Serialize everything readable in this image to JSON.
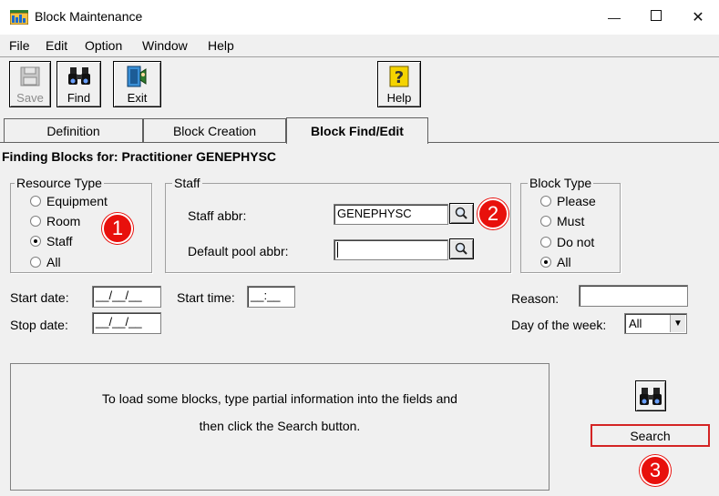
{
  "window": {
    "title": "Block Maintenance",
    "minimize_glyph": "—",
    "maximize_glyph": "☐",
    "close_glyph": "✕"
  },
  "menu": [
    "File",
    "Edit",
    "Option",
    "Window",
    "Help"
  ],
  "toolbar": {
    "save": "Save",
    "find": "Find",
    "exit": "Exit",
    "help": "Help"
  },
  "tabs": [
    {
      "label": "Definition",
      "active": false
    },
    {
      "label": "Block Creation",
      "active": false
    },
    {
      "label": "Block Find/Edit",
      "active": true
    }
  ],
  "finding_label": "Finding Blocks for: Practitioner GENEPHYSC",
  "resource_type": {
    "legend": "Resource Type",
    "options": [
      "Equipment",
      "Room",
      "Staff",
      "All"
    ],
    "selected": "Staff"
  },
  "staff": {
    "legend": "Staff",
    "staff_abbr_label": "Staff abbr:",
    "staff_abbr_value": "GENEPHYSC",
    "default_pool_label": "Default pool abbr:",
    "default_pool_value": ""
  },
  "block_type": {
    "legend": "Block Type",
    "options": [
      "Please",
      "Must",
      "Do not",
      "All"
    ],
    "selected": "All"
  },
  "dates": {
    "start_date_label": "Start date:",
    "start_date_value": "__/__/__",
    "stop_date_label": "Stop date:",
    "stop_date_value": "__/__/__",
    "start_time_label": "Start time:",
    "start_time_value": "__:__"
  },
  "reason": {
    "label": "Reason:",
    "value": ""
  },
  "day_of_week": {
    "label": "Day of the week:",
    "value": "All"
  },
  "message": {
    "line1": "To load some blocks, type partial information into the fields and",
    "line2": "then click the Search button."
  },
  "search_label": "Search",
  "badges": [
    "1",
    "2",
    "3"
  ],
  "colors": {
    "badge": "#e8100c",
    "search_highlight": "#d42424",
    "help_icon": "#f5d400"
  },
  "icons": {
    "app": "calendar-bars-icon",
    "save": "floppy-disk-icon",
    "find": "binoculars-icon",
    "exit": "exit-door-icon",
    "help": "question-mark-icon",
    "lookup": "magnifier-icon"
  }
}
